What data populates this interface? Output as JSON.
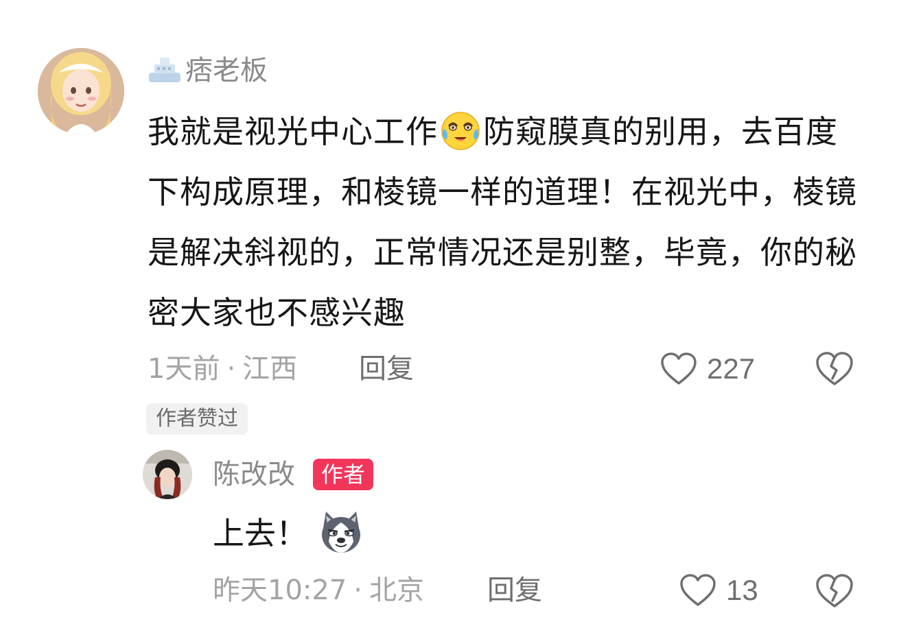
{
  "comment": {
    "username": "痞老板",
    "badge_icon": "ship-badge-icon",
    "text_before_emoji": "我就是视光中心工作",
    "inline_emoji": "crying-laughing-emoji",
    "text_after_emoji": "防窥膜真的别用，去百度下构成原理，和棱镜一样的道理！在视光中，棱镜是解决斜视的，正常情况还是别整，毕竟，你的秘密大家也不感兴趣",
    "time": "1天前",
    "location": "江西",
    "separator": "·",
    "reply_label": "回复",
    "like_count": "227",
    "author_liked_label": "作者赞过"
  },
  "reply": {
    "username": "陈改改",
    "author_tag": "作者",
    "text": "上去！",
    "emoji": "husky-dog-emoji",
    "time": "昨天10:27",
    "location": "北京",
    "separator": "·",
    "reply_label": "回复",
    "like_count": "13"
  },
  "colors": {
    "author_tag_bg": "#f2355b",
    "meta_text": "#a3a3a3",
    "icon_stroke": "#6e6e6e"
  }
}
